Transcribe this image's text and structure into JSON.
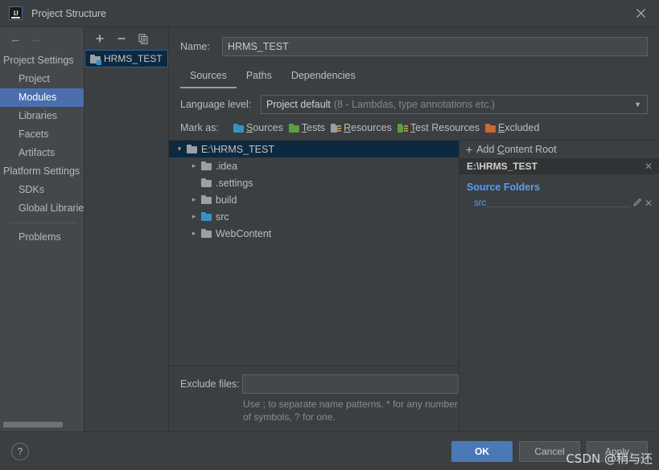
{
  "window": {
    "title": "Project Structure",
    "app_icon": "intellij-idea-logo-icon",
    "close_icon": "close-icon"
  },
  "sidebar": {
    "back_icon": "arrow-left-icon",
    "forward_icon": "arrow-right-icon",
    "groups": [
      {
        "label": "Project Settings",
        "type": "group"
      },
      {
        "label": "Project",
        "type": "child"
      },
      {
        "label": "Modules",
        "type": "child",
        "selected": true
      },
      {
        "label": "Libraries",
        "type": "child"
      },
      {
        "label": "Facets",
        "type": "child"
      },
      {
        "label": "Artifacts",
        "type": "child"
      },
      {
        "label": "Platform Settings",
        "type": "group"
      },
      {
        "label": "SDKs",
        "type": "child"
      },
      {
        "label": "Global Libraries",
        "type": "child"
      },
      {
        "label": "Problems",
        "type": "child"
      }
    ]
  },
  "modules_panel": {
    "toolbar": {
      "add_icon": "plus-icon",
      "remove_icon": "minus-icon",
      "copy_icon": "copy-icon"
    },
    "items": [
      {
        "label": "HRMS_TEST",
        "selected": true,
        "icon": "module-folder-icon"
      }
    ]
  },
  "main": {
    "name_label": "Name:",
    "name_value": "HRMS_TEST",
    "tabs": [
      {
        "label": "Sources",
        "active": true
      },
      {
        "label": "Paths",
        "active": false
      },
      {
        "label": "Dependencies",
        "active": false
      }
    ],
    "language_level": {
      "label": "Language level:",
      "value": "Project default",
      "detail": "(8 - Lambdas, type annotations etc.)",
      "arrow_icon": "chevron-down-icon"
    },
    "mark_as": {
      "label": "Mark as:",
      "options": [
        {
          "label": "Sources",
          "mnemonic": "S",
          "color": "#3592c4",
          "icon": "sources-folder-icon"
        },
        {
          "label": "Tests",
          "mnemonic": "T",
          "color": "#5a9e43",
          "icon": "tests-folder-icon"
        },
        {
          "label": "Resources",
          "mnemonic": "R",
          "color": "#9aa0a6",
          "icon": "resources-folder-icon"
        },
        {
          "label": "Test Resources",
          "mnemonic": "T",
          "color": "#5a9e43",
          "icon": "test-resources-folder-icon"
        },
        {
          "label": "Excluded",
          "mnemonic": "E",
          "color": "#cc6632",
          "icon": "excluded-folder-icon"
        }
      ]
    },
    "tree": [
      {
        "label": "E:\\HRMS_TEST",
        "depth": 0,
        "expanded": true,
        "has_children": true,
        "selected": true,
        "folder_color": "gray"
      },
      {
        "label": ".idea",
        "depth": 1,
        "expanded": false,
        "has_children": true,
        "selected": false,
        "folder_color": "gray"
      },
      {
        "label": ".settings",
        "depth": 1,
        "expanded": false,
        "has_children": false,
        "selected": false,
        "folder_color": "gray"
      },
      {
        "label": "build",
        "depth": 1,
        "expanded": false,
        "has_children": true,
        "selected": false,
        "folder_color": "gray"
      },
      {
        "label": "src",
        "depth": 1,
        "expanded": false,
        "has_children": true,
        "selected": false,
        "folder_color": "blue"
      },
      {
        "label": "WebContent",
        "depth": 1,
        "expanded": false,
        "has_children": true,
        "selected": false,
        "folder_color": "gray"
      }
    ],
    "exclude": {
      "label": "Exclude files:",
      "value": "",
      "hint": "Use ; to separate name patterns, * for any number of symbols, ? for one."
    }
  },
  "right_panel": {
    "add_content_root": "Add Content Root",
    "add_icon": "plus-icon",
    "content_root": {
      "path": "E:\\HRMS_TEST",
      "remove_icon": "close-icon"
    },
    "source_folders_title": "Source Folders",
    "source_folders": [
      {
        "name": "src",
        "edit_icon": "pencil-icon",
        "remove_icon": "close-icon"
      }
    ]
  },
  "footer": {
    "help_label": "?",
    "help_icon": "help-icon",
    "ok_label": "OK",
    "cancel_label": "Cancel",
    "apply_label": "Apply"
  },
  "watermark": {
    "text": "CSDN @稍与还"
  },
  "colors": {
    "background": "#3c3f41",
    "sidebar_background": "#45484a",
    "accent_selection": "#4b6eaf",
    "tree_selection": "#0d293f",
    "link_blue": "#589df6",
    "primary_button": "#4a7ab5"
  }
}
